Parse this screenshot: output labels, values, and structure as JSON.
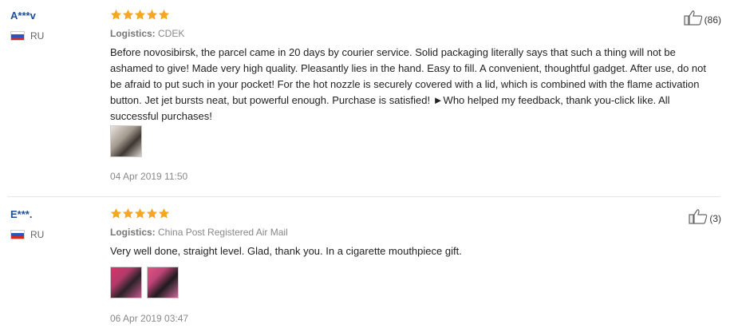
{
  "reviews": [
    {
      "user": "A***v",
      "country": "RU",
      "rating": 5,
      "logistics_label": "Logistics:",
      "logistics_value": "CDEK",
      "text": "Before novosibirsk, the parcel came in 20 days by courier service. Solid packaging literally says that such a thing will not be ashamed to give! Made very high quality. Pleasantly lies in the hand. Easy to fill. A convenient, thoughtful gadget. After use, do not be afraid to put such in your pocket! For the hot nozzle is securely covered with a lid, which is combined with the flame activation button. Jet jet bursts neat, but powerful enough. Purchase is satisfied! ►Who helped my feedback, thank you-click like. All successful purchases!",
      "date": "04 Apr 2019 11:50",
      "likes": "(86)",
      "photo_count": 1
    },
    {
      "user": "E***.",
      "country": "RU",
      "rating": 5,
      "logistics_label": "Logistics:",
      "logistics_value": "China Post Registered Air Mail",
      "text": "Very well done, straight level. Glad, thank you. In a cigarette mouthpiece gift.",
      "date": "06 Apr 2019 03:47",
      "likes": "(3)",
      "photo_count": 2
    }
  ],
  "colors": {
    "star": "#f5a623",
    "username": "#1f4e9b",
    "muted": "#888888"
  }
}
